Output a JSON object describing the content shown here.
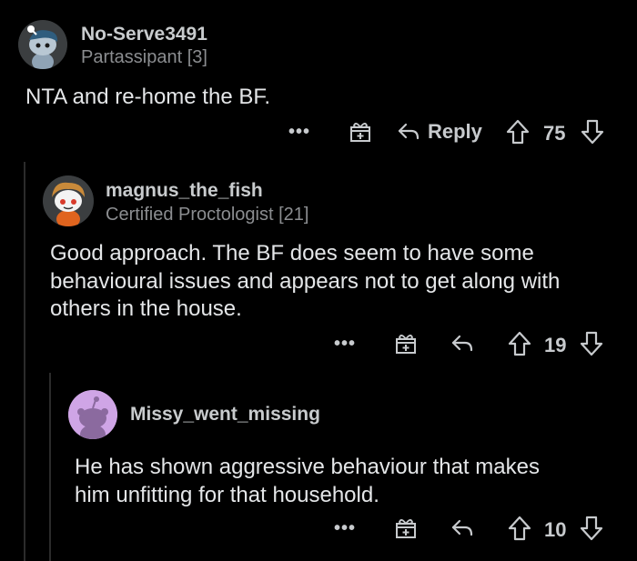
{
  "colors": {
    "background": "#000000",
    "thread_line": "#2b2b2b",
    "author_text": "#c8cbcd",
    "flair_text": "#8b8d90",
    "body_text": "#e4e6e8",
    "icon": "#c7cacd"
  },
  "comments": [
    {
      "author": "No-Serve3491",
      "flair": "Partassipant [3]",
      "body": "NTA and re-home the BF.",
      "more_label": "•••",
      "reply_label": "Reply",
      "score": "75",
      "icons": [
        "more-icon",
        "award-icon",
        "reply-icon",
        "upvote-icon",
        "downvote-icon"
      ]
    },
    {
      "author": "magnus_the_fish",
      "flair": "Certified Proctologist [21]",
      "body": "Good approach. The BF does seem to have some\nbehavioural issues and appears not to get along with\nothers in the house.",
      "more_label": "•••",
      "score": "19",
      "icons": [
        "more-icon",
        "award-icon",
        "reply-icon",
        "upvote-icon",
        "downvote-icon"
      ]
    },
    {
      "author": "Missy_went_missing",
      "body": "He has shown aggressive behaviour that makes\nhim unfitting for that household.",
      "more_label": "•••",
      "score": "10",
      "icons": [
        "more-icon",
        "award-icon",
        "reply-icon",
        "upvote-icon",
        "downvote-icon"
      ]
    }
  ]
}
